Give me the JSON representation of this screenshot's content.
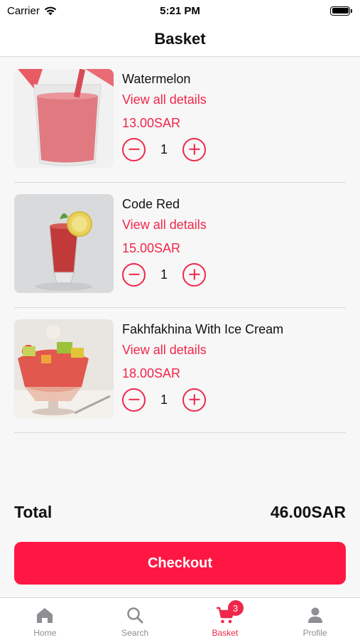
{
  "status_bar": {
    "carrier": "Carrier",
    "time": "5:21 PM"
  },
  "header": {
    "title": "Basket"
  },
  "items": [
    {
      "name": "Watermelon",
      "details_link": "View all details",
      "price": "13.00SAR",
      "quantity": "1"
    },
    {
      "name": "Code Red",
      "details_link": "View all details",
      "price": "15.00SAR",
      "quantity": "1"
    },
    {
      "name": "Fakhfakhina With Ice Cream",
      "details_link": "View all details",
      "price": "18.00SAR",
      "quantity": "1"
    }
  ],
  "total": {
    "label": "Total",
    "value": "46.00SAR"
  },
  "checkout": {
    "label": "Checkout"
  },
  "tabs": [
    {
      "label": "Home",
      "icon": "home-icon"
    },
    {
      "label": "Search",
      "icon": "search-icon"
    },
    {
      "label": "Basket",
      "icon": "cart-icon",
      "badge": "3",
      "active": true
    },
    {
      "label": "Profile",
      "icon": "person-icon"
    }
  ],
  "colors": {
    "accent": "#f0274a",
    "checkout_bg": "#ff1744",
    "inactive_tab": "#8e8e93"
  }
}
